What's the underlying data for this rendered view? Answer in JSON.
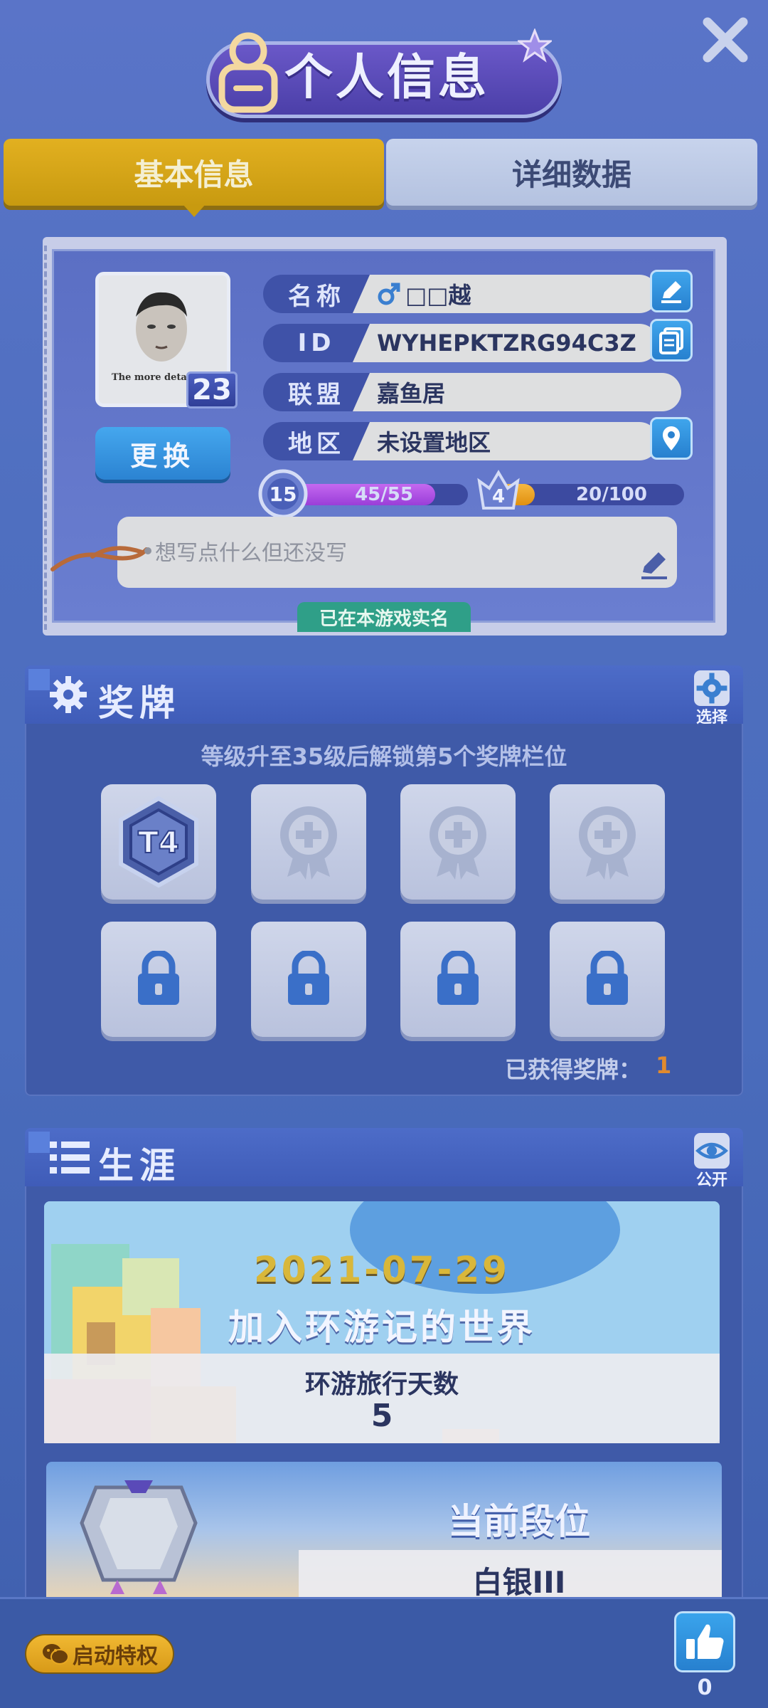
{
  "header": {
    "title": "个人信息"
  },
  "tabs": [
    {
      "label": "基本信息",
      "active": true
    },
    {
      "label": "详细数据",
      "active": false
    }
  ],
  "profile": {
    "avatar_caption": "The more deta",
    "level": "23",
    "change_label": "更换",
    "fields": {
      "name": {
        "label": "名称",
        "value": "□□越"
      },
      "id": {
        "label": "ID",
        "value": "WYHEPKTZRG94C3Z"
      },
      "alliance": {
        "label": "联盟",
        "value": "嘉鱼居"
      },
      "region": {
        "label": "地区",
        "value": "未设置地区"
      }
    },
    "level_bar": {
      "badge": "15",
      "text": "45/55",
      "fraction": 0.82
    },
    "rank_bar": {
      "badge": "4",
      "text": "20/100",
      "fraction": 0.2
    },
    "signature_placeholder": "想写点什么但还没写",
    "verified_label": "已在本游戏实名"
  },
  "medals": {
    "title": "奖牌",
    "action_label": "选择",
    "hint": "等级升至35级后解锁第5个奖牌栏位",
    "slots_row1": [
      {
        "type": "badge",
        "label": "T4",
        "icon": "t4-medal-icon"
      },
      {
        "type": "empty",
        "icon": "add-medal-icon"
      },
      {
        "type": "empty",
        "icon": "add-medal-icon"
      },
      {
        "type": "empty",
        "icon": "add-medal-icon"
      }
    ],
    "slots_row2": [
      {
        "type": "locked",
        "icon": "lock-icon"
      },
      {
        "type": "locked",
        "icon": "lock-icon"
      },
      {
        "type": "locked",
        "icon": "lock-icon"
      },
      {
        "type": "locked",
        "icon": "lock-icon"
      }
    ],
    "count_label": "已获得奖牌：",
    "count_value": "1"
  },
  "career": {
    "title": "生涯",
    "action_label": "公开",
    "join_date": "2021-07-29",
    "join_text": "加入环游记的世界",
    "days_label": "环游旅行天数",
    "days_value": "5",
    "rank_label": "当前段位",
    "rank_value": "白银III"
  },
  "bottom": {
    "privilege_label": "启动特权",
    "like_count": "0"
  },
  "colors": {
    "accent_gold": "#d4a418",
    "button_blue": "#2e88d6",
    "verified_green": "#2f9f88",
    "level_purple": "#a64ee0",
    "rank_orange": "#f0a020"
  }
}
